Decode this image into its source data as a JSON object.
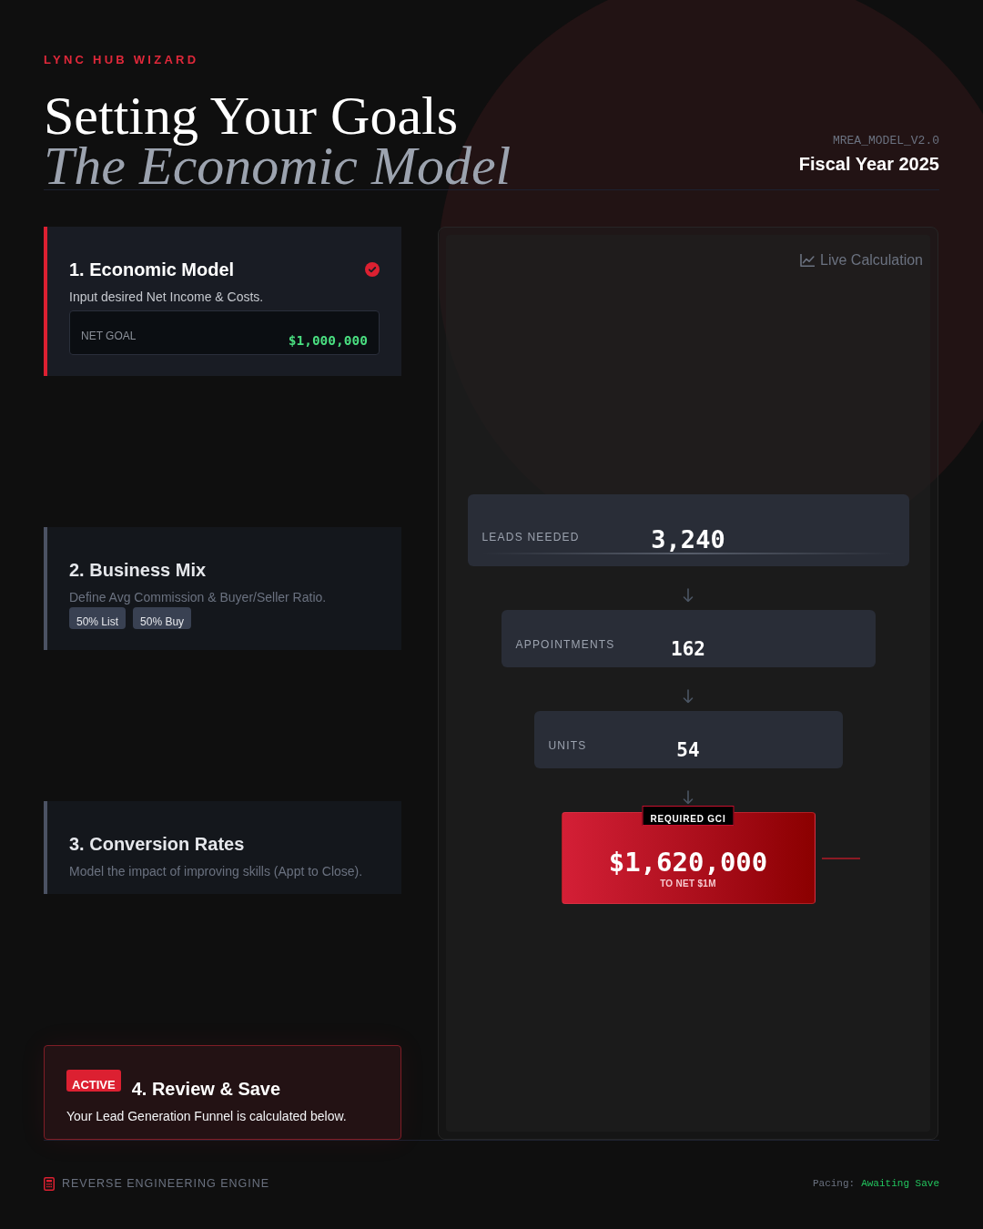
{
  "header": {
    "eyebrow": "LYNC HUB WIZARD",
    "title": "Setting Your Goals",
    "subtitle": "The Economic Model",
    "model_version": "MREA_MODEL_V2.0",
    "fiscal_year": "Fiscal Year 2025"
  },
  "steps": [
    {
      "title": "1. Economic Model",
      "description": "Input desired Net Income & Costs.",
      "completed": true,
      "active": false,
      "field": {
        "label": "NET GOAL",
        "value": "$1,000,000"
      }
    },
    {
      "title": "2. Business Mix",
      "description": "Define Avg Commission & Buyer/Seller Ratio.",
      "completed": false,
      "active": false,
      "chips": [
        "50% List",
        "50% Buy"
      ]
    },
    {
      "title": "3. Conversion Rates",
      "description": "Model the impact of improving skills (Appt to Close).",
      "completed": false,
      "active": false
    },
    {
      "title": "4. Review & Save",
      "description": "Your Lead Generation Funnel is calculated below.",
      "completed": false,
      "active": true,
      "badge": "ACTIVE"
    }
  ],
  "calculation": {
    "label": "Live Calculation",
    "funnel": [
      {
        "label": "LEADS NEEDED",
        "value": "3,240"
      },
      {
        "label": "APPOINTMENTS",
        "value": "162"
      },
      {
        "label": "UNITS",
        "value": "54"
      }
    ],
    "result": {
      "tag": "REQUIRED GCI",
      "value": "$1,620,000",
      "caption": "TO NET $1M"
    }
  },
  "footer": {
    "engine": "REVERSE ENGINEERING ENGINE",
    "pacing_label": "Pacing:",
    "pacing_status": "Awaiting Save"
  }
}
